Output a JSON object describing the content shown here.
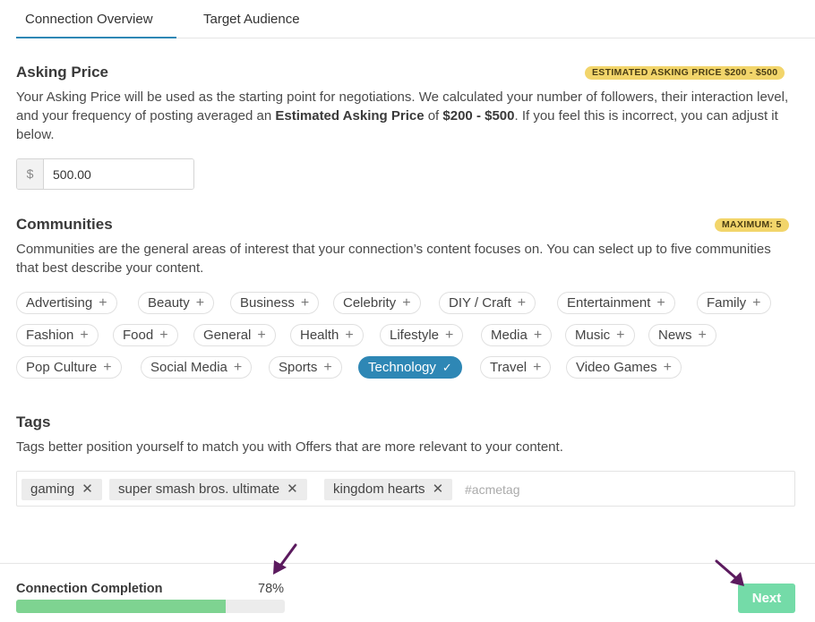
{
  "tabs": [
    {
      "label": "Connection Overview",
      "active": true
    },
    {
      "label": "Target Audience",
      "active": false
    }
  ],
  "asking_price": {
    "title": "Asking Price",
    "badge": "ESTIMATED ASKING PRICE $200 - $500",
    "desc_part1": "Your Asking Price will be used as the starting point for negotiations. We calculated your number of followers, their interaction level, and your frequency of posting averaged an ",
    "desc_bold1": "Estimated Asking Price",
    "desc_part2": " of ",
    "desc_bold2": "$200 - $500",
    "desc_part3": ". If you feel this is incorrect, you can adjust it below.",
    "currency_symbol": "$",
    "value": "500.00"
  },
  "communities": {
    "title": "Communities",
    "badge": "MAXIMUM: 5",
    "description": "Communities are the general areas of interest that your connection’s content focuses on. You can select up to five communities that best describe your content.",
    "items": [
      {
        "label": "Advertising",
        "selected": false
      },
      {
        "label": "Beauty",
        "selected": false
      },
      {
        "label": "Business",
        "selected": false
      },
      {
        "label": "Celebrity",
        "selected": false
      },
      {
        "label": "DIY / Craft",
        "selected": false
      },
      {
        "label": "Entertainment",
        "selected": false
      },
      {
        "label": "Family",
        "selected": false
      },
      {
        "label": "Fashion",
        "selected": false
      },
      {
        "label": "Food",
        "selected": false
      },
      {
        "label": "General",
        "selected": false
      },
      {
        "label": "Health",
        "selected": false
      },
      {
        "label": "Lifestyle",
        "selected": false
      },
      {
        "label": "Media",
        "selected": false
      },
      {
        "label": "Music",
        "selected": false
      },
      {
        "label": "News",
        "selected": false
      },
      {
        "label": "Pop Culture",
        "selected": false
      },
      {
        "label": "Social Media",
        "selected": false
      },
      {
        "label": "Sports",
        "selected": false
      },
      {
        "label": "Technology",
        "selected": true
      },
      {
        "label": "Travel",
        "selected": false
      },
      {
        "label": "Video Games",
        "selected": false
      }
    ]
  },
  "tags": {
    "title": "Tags",
    "description": "Tags better position yourself to match you with Offers that are more relevant to your content.",
    "items": [
      "gaming",
      "super smash bros. ultimate",
      "kingdom hearts"
    ],
    "placeholder": "#acmetag"
  },
  "footer": {
    "completion_label": "Connection Completion",
    "completion_pct": "78%",
    "progress_fraction": 0.78,
    "next_label": "Next"
  },
  "colors": {
    "accent": "#2e87b5",
    "badge": "#f2d56b",
    "progress": "#7ed391",
    "next_button": "#74dba8",
    "annotation_arrow": "#5b1a5e"
  },
  "icons": {
    "add": "plus-icon",
    "selected": "check-icon",
    "remove_tag": "close-icon",
    "annotation": "arrow-icon"
  }
}
